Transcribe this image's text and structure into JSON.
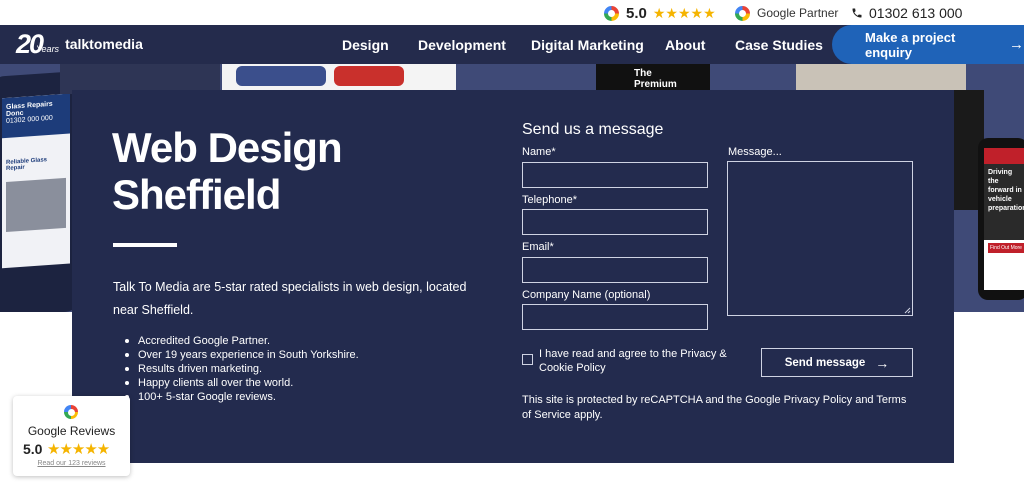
{
  "topbar": {
    "rating": "5.0",
    "stars": "★★★★★",
    "google_partner": "Google Partner",
    "phone": "01302 613 000"
  },
  "nav": {
    "logo_number": "20",
    "logo_years": "Years",
    "logo_text": "talktomedia",
    "items": [
      "Design",
      "Development",
      "Digital Marketing",
      "About",
      "Case Studies"
    ],
    "cta_label": "Make a project enquiry"
  },
  "hero": {
    "title_line1": "Web Design",
    "title_line2": "Sheffield",
    "intro": "Talk To Media are 5-star rated specialists in web design, located near Sheffield.",
    "bullets": [
      "Accredited Google Partner.",
      "Over 19 years experience in South Yorkshire.",
      "Results driven marketing.",
      "Happy clients all over the world.",
      "100+ 5-star Google reviews."
    ]
  },
  "form": {
    "title": "Send us a message",
    "name_label": "Name*",
    "telephone_label": "Telephone*",
    "email_label": "Email*",
    "company_label": "Company Name (optional)",
    "message_label": "Message...",
    "consent_text": "I have read and agree to the Privacy & Cookie Policy",
    "send_label": "Send message",
    "recaptcha_text": "This site is protected by reCAPTCHA and the Google Privacy Policy and Terms of Service apply."
  },
  "reviews_badge": {
    "title": "Google Reviews",
    "score": "5.0",
    "stars": "★★★★★",
    "link": "Read our 123 reviews"
  },
  "background_text": {
    "glass_title": "Glass Repairs Donc",
    "glass_phone": "01302 000 000",
    "reliable": "Reliable Glass Repair",
    "premium_line1": "The",
    "premium_line2": "Premium",
    "driving": "Driving the forward in vehicle preparation",
    "find_out": "Find Out More"
  },
  "colors": {
    "nav_bg": "#242b4c",
    "card_bg": "#232b4e",
    "cta_bg": "#1f63b8",
    "star": "#f5b400"
  }
}
